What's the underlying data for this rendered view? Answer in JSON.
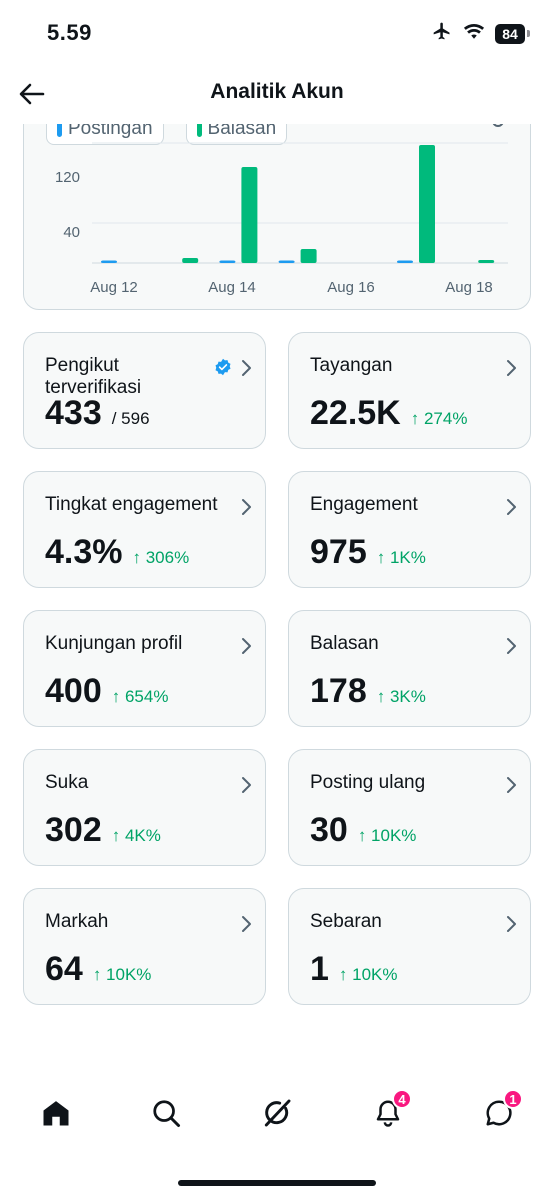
{
  "status_bar": {
    "time": "5.59",
    "battery": "84",
    "icons": [
      "airplane-icon",
      "wifi-icon",
      "battery-icon"
    ]
  },
  "header": {
    "title": "Analitik Akun",
    "back_icon": "arrow-left-icon"
  },
  "chart": {
    "legend": [
      {
        "name": "Postingan",
        "color": "#1d9bf0"
      },
      {
        "name": "Balasan",
        "color": "#00ba7c"
      }
    ],
    "y_ticks": [
      "120",
      "40"
    ],
    "x_ticks": [
      "Aug 12",
      "Aug 14",
      "Aug 16",
      "Aug 18"
    ]
  },
  "chart_data": {
    "type": "bar",
    "categories": [
      "Aug 12",
      "Aug 13",
      "Aug 14",
      "Aug 15",
      "Aug 16",
      "Aug 17",
      "Aug 18"
    ],
    "series": [
      {
        "name": "Postingan",
        "color": "#1d9bf0",
        "values": [
          1,
          0,
          1,
          2,
          0,
          2,
          0
        ]
      },
      {
        "name": "Balasan",
        "color": "#00ba7c",
        "values": [
          0,
          5,
          96,
          14,
          0,
          118,
          3
        ]
      }
    ],
    "yticks": [
      40,
      120
    ],
    "ylim": [
      0,
      160
    ],
    "grid": true
  },
  "metrics": [
    {
      "label": "Pengikut terverifikasi",
      "value": "433",
      "sub": "/ 596",
      "change": "",
      "verified": true
    },
    {
      "label": "Tayangan",
      "value": "22.5K",
      "sub": "",
      "change": "↑ 274%"
    },
    {
      "label": "Tingkat engagement",
      "value": "4.3%",
      "sub": "",
      "change": "↑ 306%"
    },
    {
      "label": "Engagement",
      "value": "975",
      "sub": "",
      "change": "↑ 1K%"
    },
    {
      "label": "Kunjungan profil",
      "value": "400",
      "sub": "",
      "change": "↑ 654%"
    },
    {
      "label": "Balasan",
      "value": "178",
      "sub": "",
      "change": "↑ 3K%"
    },
    {
      "label": "Suka",
      "value": "302",
      "sub": "",
      "change": "↑ 4K%"
    },
    {
      "label": "Posting ulang",
      "value": "30",
      "sub": "",
      "change": "↑ 10K%"
    },
    {
      "label": "Markah",
      "value": "64",
      "sub": "",
      "change": "↑ 10K%"
    },
    {
      "label": "Sebaran",
      "value": "1",
      "sub": "",
      "change": "↑ 10K%"
    }
  ],
  "colors": {
    "positive": "#00a366",
    "verified": "#1d9bf0",
    "badge": "#f91880"
  },
  "bottom_nav": {
    "items": [
      {
        "icon": "home-icon",
        "badge": ""
      },
      {
        "icon": "search-icon",
        "badge": ""
      },
      {
        "icon": "grok-icon",
        "badge": ""
      },
      {
        "icon": "bell-icon",
        "badge": "4"
      },
      {
        "icon": "messages-icon",
        "badge": "1"
      }
    ]
  }
}
